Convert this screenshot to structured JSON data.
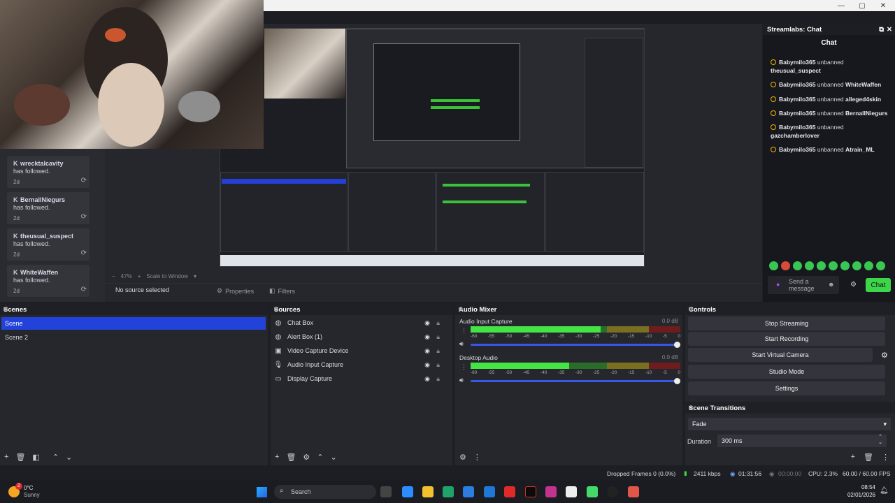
{
  "window": {
    "minimize": "—",
    "maximize": "▢",
    "close": "✕"
  },
  "alerts": [
    {
      "name": "wrecktalcavity",
      "action": "has followed.",
      "ago": "2d"
    },
    {
      "name": "BernallNiegurs",
      "action": "has followed.",
      "ago": "2d"
    },
    {
      "name": "theusual_suspect",
      "action": "has followed.",
      "ago": "2d"
    },
    {
      "name": "WhiteWaffen",
      "action": "has followed.",
      "ago": "2d"
    }
  ],
  "preview": {
    "zoom": "47%",
    "scale_mode": "Scale to Window"
  },
  "source_toolbar": {
    "status": "No source selected",
    "properties": "Properties",
    "filters": "Filters"
  },
  "chat": {
    "dock_title": "Streamlabs: Chat",
    "title": "Chat",
    "messages": [
      {
        "user": "Babymilo365",
        "text": "unbanned",
        "target": "theusual_suspect"
      },
      {
        "user": "Babymilo365",
        "text": "unbanned",
        "target": "WhiteWaffen"
      },
      {
        "user": "Babymilo365",
        "text": "unbanned",
        "target": "alleged4skin"
      },
      {
        "user": "Babymilo365",
        "text": "unbanned",
        "target": "BernallNiegurs"
      },
      {
        "user": "Babymilo365",
        "text": "unbanned",
        "target": "gazchamberlover"
      },
      {
        "user": "Babymilo365",
        "text": "unbanned",
        "target": "Atrain_ML"
      }
    ],
    "input_placeholder": "Send a message",
    "send_label": "Chat"
  },
  "scenes": {
    "title": "Scenes",
    "items": [
      {
        "label": "Scene",
        "selected": true
      },
      {
        "label": "Scene 2",
        "selected": false
      }
    ]
  },
  "sources": {
    "title": "Sources",
    "items": [
      {
        "label": "Chat Box",
        "icon": "browser-icon"
      },
      {
        "label": "Alert Box (1)",
        "icon": "browser-icon"
      },
      {
        "label": "Video Capture Device",
        "icon": "camera-icon"
      },
      {
        "label": "Audio Input Capture",
        "icon": "microphone-icon"
      },
      {
        "label": "Display Capture",
        "icon": "monitor-icon"
      }
    ]
  },
  "mixer": {
    "title": "Audio Mixer",
    "channels": [
      {
        "name": "Audio Input Capture",
        "db": "0.0 dB",
        "level": 0.62
      },
      {
        "name": "Desktop Audio",
        "db": "0.0 dB",
        "level": 0.47
      }
    ],
    "ticks": [
      "-60",
      "-55",
      "-50",
      "-45",
      "-40",
      "-35",
      "-30",
      "-25",
      "-20",
      "-15",
      "-10",
      "-5",
      "0"
    ]
  },
  "controls": {
    "title": "Controls",
    "buttons": [
      "Stop Streaming",
      "Start Recording",
      "Start Virtual Camera",
      "Studio Mode",
      "Settings"
    ]
  },
  "transitions": {
    "title": "Scene Transitions",
    "selected": "Fade",
    "duration_label": "Duration",
    "duration_value": "300 ms"
  },
  "status": {
    "dropped": "Dropped Frames 0 (0.0%)",
    "bitrate": "2411 kbps",
    "stream_time": "01:31:56",
    "rec_time": "00:00:00",
    "cpu": "CPU: 2.3%",
    "fps": "60.00 / 60.00 FPS"
  },
  "taskbar": {
    "weather_temp": "0°C",
    "weather_desc": "Sunny",
    "notif_count": "2",
    "search": "Search",
    "time": "08:54",
    "date": "02/01/2026"
  },
  "colors": {
    "accent": "#2342d9",
    "chat_button": "#3dd64b",
    "meter_green": "#45e445"
  }
}
